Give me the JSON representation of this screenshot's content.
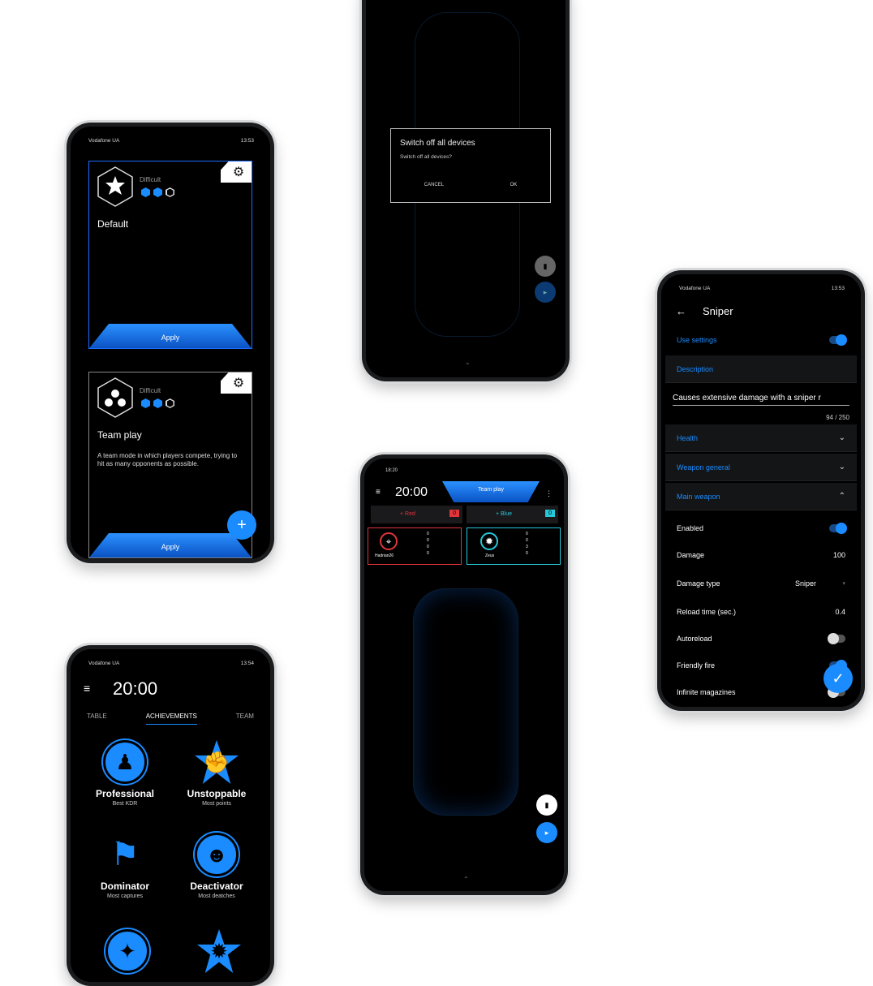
{
  "status_left": "Vodafone UA",
  "phone1": {
    "time": "13:53",
    "cards": [
      {
        "title": "Default",
        "difficulty_label": "Difficult",
        "apply_label": "Apply",
        "description": ""
      },
      {
        "title": "Team play",
        "difficulty_label": "Difficult",
        "apply_label": "Apply",
        "description": "A team mode in which players compete, trying to hit as many opponents as possible."
      }
    ],
    "fab_label": "+"
  },
  "phone2": {
    "dialog_title": "Switch off all devices",
    "dialog_text": "Switch off all devices?",
    "cancel_label": "CANCEL",
    "ok_label": "OK"
  },
  "phone3": {
    "time": "13:53",
    "title": "Sniper",
    "use_settings_label": "Use settings",
    "description_label": "Description",
    "description_value": "Causes extensive damage with a sniper r",
    "char_count": "94 / 250",
    "sections": [
      "Health",
      "Weapon general",
      "Main weapon"
    ],
    "fields": [
      {
        "label": "Enabled",
        "value": "",
        "kind": "toggle-on"
      },
      {
        "label": "Damage",
        "value": "100",
        "kind": "text"
      },
      {
        "label": "Damage type",
        "value": "Sniper",
        "kind": "select"
      },
      {
        "label": "Reload time (sec.)",
        "value": "0.4",
        "kind": "text"
      },
      {
        "label": "Autoreload",
        "value": "",
        "kind": "toggle-off"
      },
      {
        "label": "Friendly fire",
        "value": "",
        "kind": "toggle-on"
      },
      {
        "label": "Infinite magazines",
        "value": "",
        "kind": "toggle-off"
      }
    ]
  },
  "phone4": {
    "time_small": "18:20",
    "timer": "20:00",
    "mode": "Team play",
    "teams": [
      {
        "name": "+ Red",
        "score": "0",
        "color": "#e0353b",
        "player": "Hadrian26",
        "stats": [
          "0",
          "0",
          "0",
          "0"
        ]
      },
      {
        "name": "+ Blue",
        "score": "0",
        "color": "#25c7d9",
        "player": "Zeus",
        "stats": [
          "0",
          "0",
          "3",
          "0"
        ]
      }
    ]
  },
  "phone5": {
    "time": "13:54",
    "timer": "20:00",
    "tabs": [
      "TABLE",
      "ACHIEVEMENTS",
      "TEAM"
    ],
    "achievements": [
      {
        "name": "Professional",
        "sub": "Best KDR",
        "icon": "businessman-icon"
      },
      {
        "name": "Unstoppable",
        "sub": "Most points",
        "icon": "fist-icon"
      },
      {
        "name": "Dominator",
        "sub": "Most captures",
        "icon": "flag-icon"
      },
      {
        "name": "Deactivator",
        "sub": "Most deatches",
        "icon": "sapper-icon"
      }
    ]
  },
  "accent": "#1a8cff"
}
